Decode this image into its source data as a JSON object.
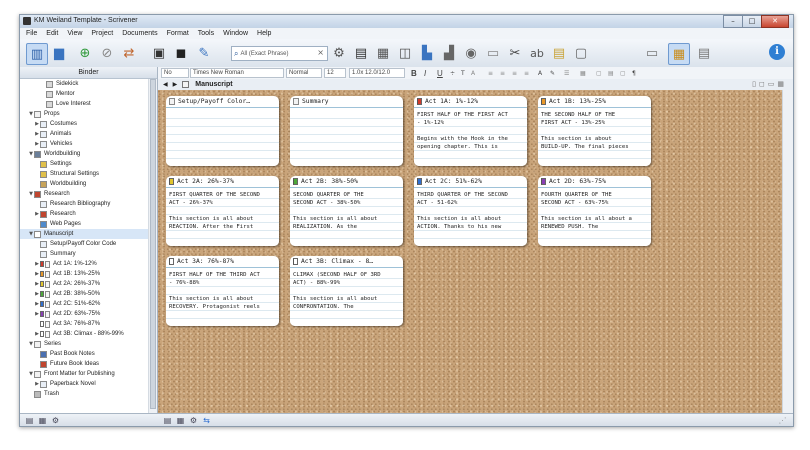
{
  "window": {
    "title": "KM Weiland Template - Scrivener",
    "controls": [
      "–",
      "□",
      "✕"
    ]
  },
  "menu": [
    "File",
    "Edit",
    "View",
    "Project",
    "Documents",
    "Format",
    "Tools",
    "Window",
    "Help"
  ],
  "toolbar": {
    "search_placeholder": "All (Exact Phrase)",
    "search_clear": "×",
    "info_label": "i"
  },
  "format_bar": {
    "style": "No Style",
    "font": "Times New Roman",
    "weight": "Normal",
    "size": "12",
    "spacing": "1.0x 12.0/12.0",
    "bold": "B",
    "italic": "I",
    "underline": "U"
  },
  "editor_header": {
    "title": "Manuscript"
  },
  "binder": {
    "header": "Binder",
    "items": [
      {
        "label": "Sidekick",
        "indent": 2,
        "icon": "character-icon",
        "tri": ""
      },
      {
        "label": "Mentor",
        "indent": 2,
        "icon": "character-icon",
        "tri": ""
      },
      {
        "label": "Love Interest",
        "indent": 2,
        "icon": "character-icon",
        "tri": ""
      },
      {
        "label": "Props",
        "indent": 0,
        "icon": "folder-icon",
        "tri": "▼"
      },
      {
        "label": "Costumes",
        "indent": 1,
        "icon": "document-icon",
        "tri": "▶"
      },
      {
        "label": "Animals",
        "indent": 1,
        "icon": "document-icon",
        "tri": "▶"
      },
      {
        "label": "Vehicles",
        "indent": 1,
        "icon": "document-icon",
        "tri": "▶"
      },
      {
        "label": "Worldbuilding",
        "indent": 0,
        "icon": "worldbuilding-icon",
        "tri": "▼"
      },
      {
        "label": "Settings",
        "indent": 1,
        "icon": "settings-icon",
        "tri": ""
      },
      {
        "label": "Structural Settings",
        "indent": 1,
        "icon": "settings-icon",
        "tri": ""
      },
      {
        "label": "Worldbuilding",
        "indent": 1,
        "icon": "map-icon",
        "tri": ""
      },
      {
        "label": "Research",
        "indent": 0,
        "icon": "research-icon",
        "tri": "▼"
      },
      {
        "label": "Research Bibliography",
        "indent": 1,
        "icon": "document-icon",
        "tri": ""
      },
      {
        "label": "Research",
        "indent": 1,
        "icon": "research-icon",
        "tri": "▶"
      },
      {
        "label": "Web Pages",
        "indent": 1,
        "icon": "web-icon",
        "tri": ""
      },
      {
        "label": "Manuscript",
        "indent": 0,
        "icon": "manuscript-icon",
        "tri": "▼",
        "selected": true
      },
      {
        "label": "Setup/Payoff Color Code",
        "indent": 1,
        "icon": "document-icon",
        "tri": ""
      },
      {
        "label": "Summary",
        "indent": 1,
        "icon": "document-icon",
        "tri": ""
      },
      {
        "label": "Act 1A: 1%-12%",
        "indent": 1,
        "icon": "flag-red-icon",
        "tri": "▶",
        "flag": "#d23b2b"
      },
      {
        "label": "Act 1B: 13%-25%",
        "indent": 1,
        "icon": "flag-orange-icon",
        "tri": "▶",
        "flag": "#e8982a"
      },
      {
        "label": "Act 2A: 26%-37%",
        "indent": 1,
        "icon": "flag-yellow-icon",
        "tri": "▶",
        "flag": "#e2c62d"
      },
      {
        "label": "Act 2B: 38%-50%",
        "indent": 1,
        "icon": "flag-green-icon",
        "tri": "▶",
        "flag": "#4da83a"
      },
      {
        "label": "Act 2C: 51%-62%",
        "indent": 1,
        "icon": "flag-blue-icon",
        "tri": "▶",
        "flag": "#2f6fd0"
      },
      {
        "label": "Act 2D: 63%-75%",
        "indent": 1,
        "icon": "flag-purple-icon",
        "tri": "▶",
        "flag": "#8a3fb5"
      },
      {
        "label": "Act 3A: 76%-87%",
        "indent": 1,
        "icon": "flag-white-icon",
        "tri": "",
        "flag": "#ffffff"
      },
      {
        "label": "Act 3B: Climax - 88%-99%",
        "indent": 1,
        "icon": "flag-white-icon",
        "tri": "▶",
        "flag": "#ffffff"
      },
      {
        "label": "Series",
        "indent": 0,
        "icon": "series-icon",
        "tri": "▼"
      },
      {
        "label": "Past Book Notes",
        "indent": 1,
        "icon": "notes-blue-icon",
        "tri": ""
      },
      {
        "label": "Future Book Ideas",
        "indent": 1,
        "icon": "notes-red-icon",
        "tri": ""
      },
      {
        "label": "Front Matter for Publishing",
        "indent": 0,
        "icon": "front-matter-icon",
        "tri": "▼"
      },
      {
        "label": "Paperback Novel",
        "indent": 1,
        "icon": "document-icon",
        "tri": "▶"
      },
      {
        "label": "Trash",
        "indent": 0,
        "icon": "trash-icon",
        "tri": ""
      }
    ]
  },
  "cards": [
    {
      "title": "Setup/Payoff Color…",
      "flag": "",
      "body": ""
    },
    {
      "title": "Summary",
      "flag": "",
      "body": ""
    },
    {
      "title": "Act 1A: 1%-12%",
      "flag": "#d23b2b",
      "body": "FIRST HALF OF THE FIRST ACT\n- 1%-12%\n\nBegins with the Hook in the\nopening chapter. This is"
    },
    {
      "title": "Act 1B: 13%-25%",
      "flag": "#e8982a",
      "body": "THE SECOND HALF OF THE\nFIRST ACT - 13%-25%\n\nThis section is about\nBUILD-UP. The final pieces"
    },
    {
      "title": "Act 2A: 26%-37%",
      "flag": "#e2c62d",
      "body": "FIRST QUARTER OF THE SECOND\nACT - 26%-37%\n\nThis section is all about\nREACTION. After the First"
    },
    {
      "title": "Act 2B: 38%-50%",
      "flag": "#4da83a",
      "body": "SECOND QUARTER OF THE\nSECOND ACT - 38%-50%\n\nThis section is all about\nREALIZATION. As the"
    },
    {
      "title": "Act 2C: 51%-62%",
      "flag": "#2f6fd0",
      "body": "THIRD QUARTER OF THE SECOND\nACT - 51-62%\n\nThis section is all about\nACTION. Thanks to his new"
    },
    {
      "title": "Act 2D: 63%-75%",
      "flag": "#8a3fb5",
      "body": "FOURTH QUARTER OF THE\nSECOND ACT - 63%-75%\n\nThis section is all about a\nRENEWED PUSH. The"
    },
    {
      "title": "Act 3A: 76%-87%",
      "flag": "#ffffff",
      "body": "FIRST HALF OF THE THIRD ACT\n- 76%-88%\n\nThis section is all about\nRECOVERY. Protagonist reels"
    },
    {
      "title": "Act 3B: Climax - 8…",
      "flag": "#ffffff",
      "body": "CLIMAX (SECOND HALF OF 3RD\nACT) - 88%-99%\n\nThis section is all about\nCONFRONTATION. The"
    }
  ]
}
